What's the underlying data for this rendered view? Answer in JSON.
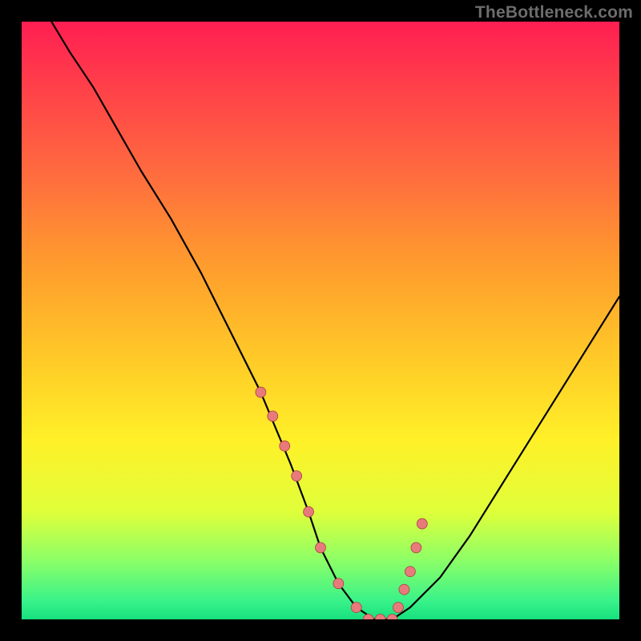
{
  "watermark": "TheBottleneck.com",
  "border_color": "#000000",
  "chart_data": {
    "type": "line",
    "title": "",
    "xlabel": "",
    "ylabel": "",
    "xlim": [
      0,
      100
    ],
    "ylim": [
      0,
      100
    ],
    "grid": false,
    "series": [
      {
        "name": "bottleneck-curve",
        "color": "#000000",
        "x": [
          5,
          8,
          12,
          16,
          20,
          25,
          30,
          35,
          40,
          45,
          48,
          50,
          53,
          56,
          59,
          62,
          65,
          70,
          75,
          80,
          85,
          90,
          95,
          100
        ],
        "y": [
          100,
          95,
          89,
          82,
          75,
          67,
          58,
          48,
          38,
          26,
          18,
          12,
          6,
          2,
          0,
          0,
          2,
          7,
          14,
          22,
          30,
          38,
          46,
          54
        ]
      }
    ],
    "markers": {
      "name": "data-points",
      "color": "#e97a7c",
      "x": [
        40,
        42,
        44,
        46,
        48,
        50,
        53,
        56,
        58,
        60,
        62,
        63,
        64,
        65,
        66,
        67
      ],
      "y": [
        38,
        34,
        29,
        24,
        18,
        12,
        6,
        2,
        0,
        0,
        0,
        2,
        5,
        8,
        12,
        16
      ]
    },
    "background_gradient": {
      "top": "#ff1e52",
      "bottom": "#17e07e"
    }
  }
}
